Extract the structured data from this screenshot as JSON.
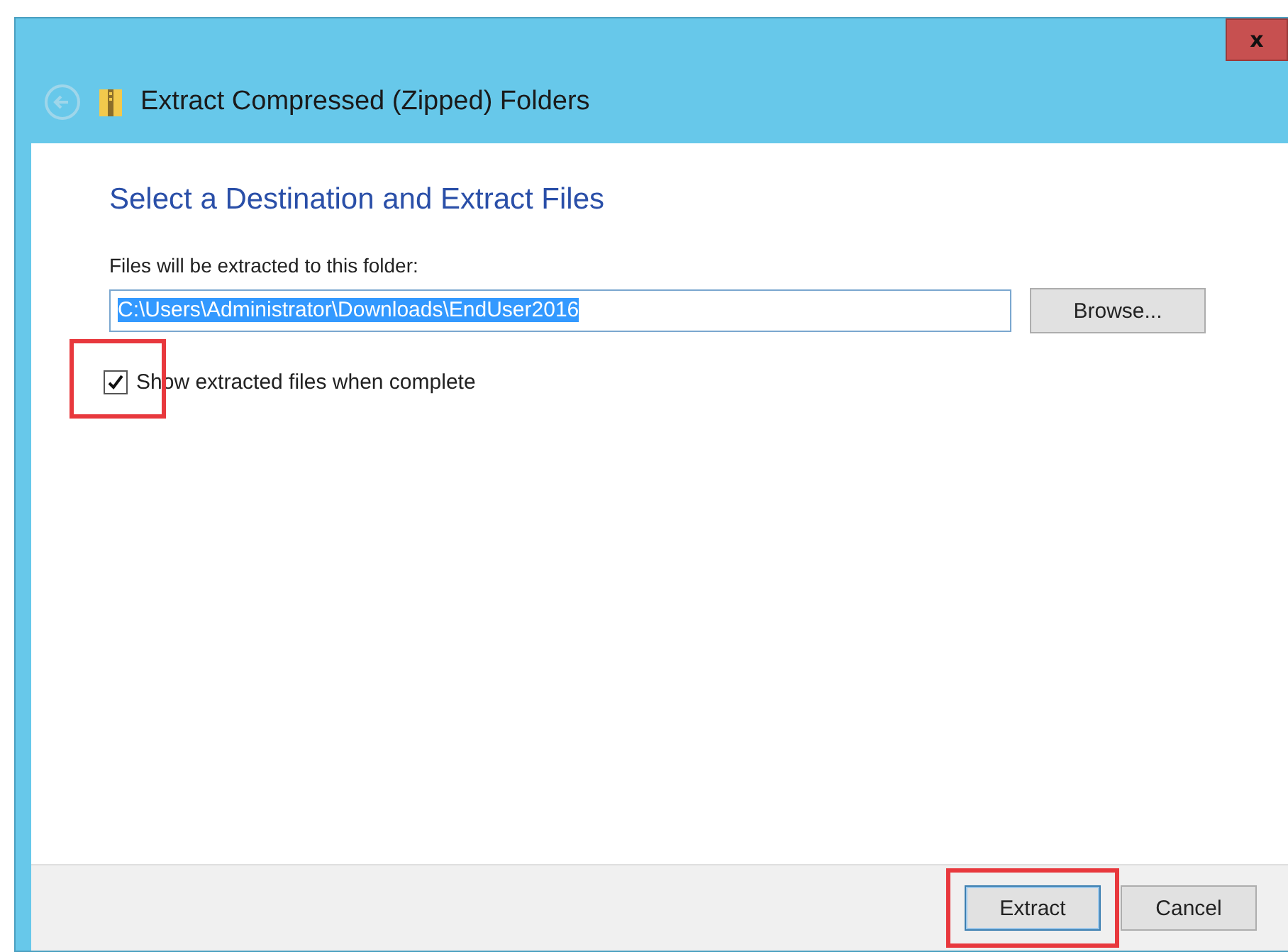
{
  "window": {
    "title": "Extract Compressed (Zipped) Folders",
    "close": "x"
  },
  "heading": "Select a Destination and Extract Files",
  "folder_field": {
    "label": "Files will be extracted to this folder:",
    "value": "C:\\Users\\Administrator\\Downloads\\EndUser2016",
    "text_selected": true
  },
  "browse_button": {
    "label": "Browse..."
  },
  "show_files": {
    "label": "Show extracted files when complete",
    "checked": true,
    "highlighted": true
  },
  "buttons": [
    {
      "label": "Extract",
      "default": true,
      "highlighted": true
    },
    {
      "label": "Cancel",
      "default": false,
      "highlighted": false
    }
  ]
}
